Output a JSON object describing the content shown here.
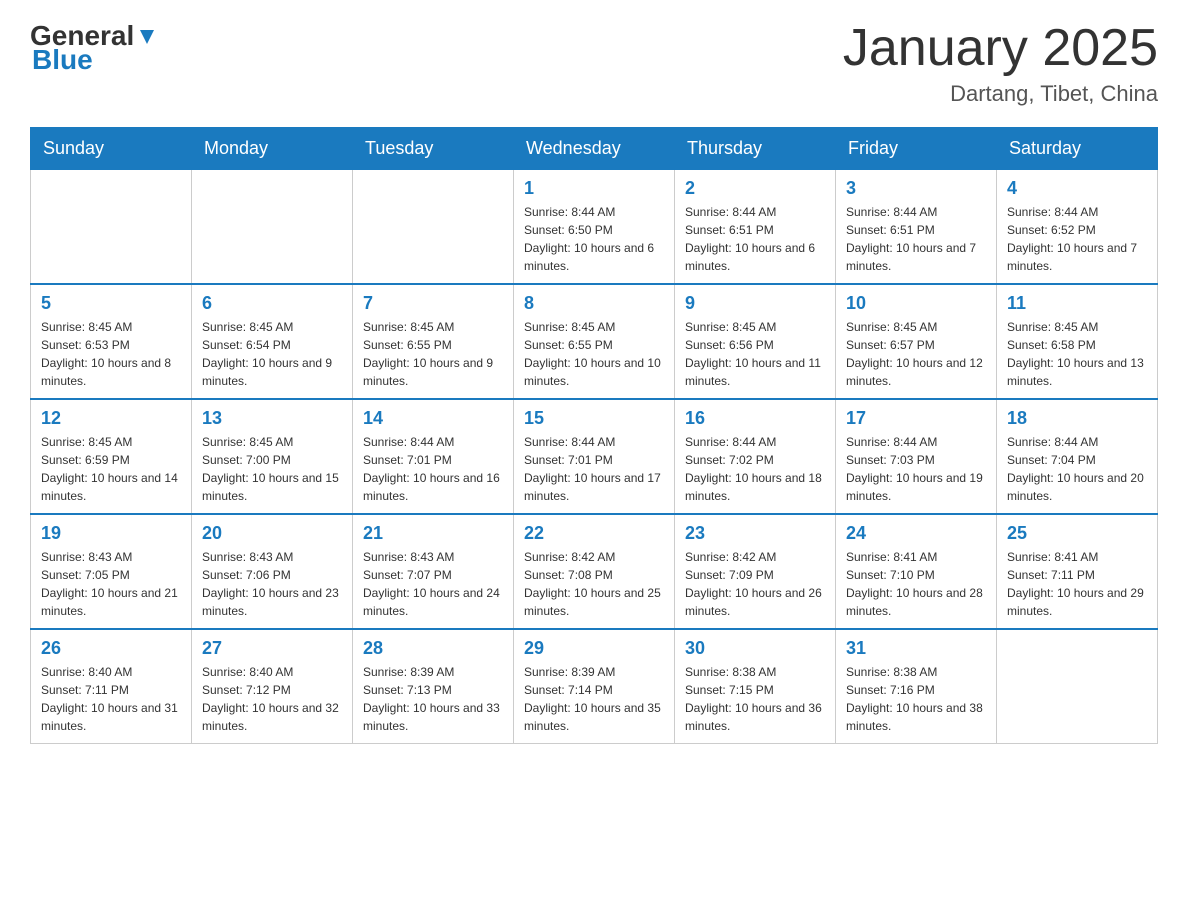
{
  "header": {
    "logo": {
      "general": "General",
      "blue": "Blue"
    },
    "title": "January 2025",
    "subtitle": "Dartang, Tibet, China"
  },
  "days_of_week": [
    "Sunday",
    "Monday",
    "Tuesday",
    "Wednesday",
    "Thursday",
    "Friday",
    "Saturday"
  ],
  "weeks": [
    {
      "days": [
        {
          "number": "",
          "info": ""
        },
        {
          "number": "",
          "info": ""
        },
        {
          "number": "",
          "info": ""
        },
        {
          "number": "1",
          "info": "Sunrise: 8:44 AM\nSunset: 6:50 PM\nDaylight: 10 hours and 6 minutes."
        },
        {
          "number": "2",
          "info": "Sunrise: 8:44 AM\nSunset: 6:51 PM\nDaylight: 10 hours and 6 minutes."
        },
        {
          "number": "3",
          "info": "Sunrise: 8:44 AM\nSunset: 6:51 PM\nDaylight: 10 hours and 7 minutes."
        },
        {
          "number": "4",
          "info": "Sunrise: 8:44 AM\nSunset: 6:52 PM\nDaylight: 10 hours and 7 minutes."
        }
      ]
    },
    {
      "days": [
        {
          "number": "5",
          "info": "Sunrise: 8:45 AM\nSunset: 6:53 PM\nDaylight: 10 hours and 8 minutes."
        },
        {
          "number": "6",
          "info": "Sunrise: 8:45 AM\nSunset: 6:54 PM\nDaylight: 10 hours and 9 minutes."
        },
        {
          "number": "7",
          "info": "Sunrise: 8:45 AM\nSunset: 6:55 PM\nDaylight: 10 hours and 9 minutes."
        },
        {
          "number": "8",
          "info": "Sunrise: 8:45 AM\nSunset: 6:55 PM\nDaylight: 10 hours and 10 minutes."
        },
        {
          "number": "9",
          "info": "Sunrise: 8:45 AM\nSunset: 6:56 PM\nDaylight: 10 hours and 11 minutes."
        },
        {
          "number": "10",
          "info": "Sunrise: 8:45 AM\nSunset: 6:57 PM\nDaylight: 10 hours and 12 minutes."
        },
        {
          "number": "11",
          "info": "Sunrise: 8:45 AM\nSunset: 6:58 PM\nDaylight: 10 hours and 13 minutes."
        }
      ]
    },
    {
      "days": [
        {
          "number": "12",
          "info": "Sunrise: 8:45 AM\nSunset: 6:59 PM\nDaylight: 10 hours and 14 minutes."
        },
        {
          "number": "13",
          "info": "Sunrise: 8:45 AM\nSunset: 7:00 PM\nDaylight: 10 hours and 15 minutes."
        },
        {
          "number": "14",
          "info": "Sunrise: 8:44 AM\nSunset: 7:01 PM\nDaylight: 10 hours and 16 minutes."
        },
        {
          "number": "15",
          "info": "Sunrise: 8:44 AM\nSunset: 7:01 PM\nDaylight: 10 hours and 17 minutes."
        },
        {
          "number": "16",
          "info": "Sunrise: 8:44 AM\nSunset: 7:02 PM\nDaylight: 10 hours and 18 minutes."
        },
        {
          "number": "17",
          "info": "Sunrise: 8:44 AM\nSunset: 7:03 PM\nDaylight: 10 hours and 19 minutes."
        },
        {
          "number": "18",
          "info": "Sunrise: 8:44 AM\nSunset: 7:04 PM\nDaylight: 10 hours and 20 minutes."
        }
      ]
    },
    {
      "days": [
        {
          "number": "19",
          "info": "Sunrise: 8:43 AM\nSunset: 7:05 PM\nDaylight: 10 hours and 21 minutes."
        },
        {
          "number": "20",
          "info": "Sunrise: 8:43 AM\nSunset: 7:06 PM\nDaylight: 10 hours and 23 minutes."
        },
        {
          "number": "21",
          "info": "Sunrise: 8:43 AM\nSunset: 7:07 PM\nDaylight: 10 hours and 24 minutes."
        },
        {
          "number": "22",
          "info": "Sunrise: 8:42 AM\nSunset: 7:08 PM\nDaylight: 10 hours and 25 minutes."
        },
        {
          "number": "23",
          "info": "Sunrise: 8:42 AM\nSunset: 7:09 PM\nDaylight: 10 hours and 26 minutes."
        },
        {
          "number": "24",
          "info": "Sunrise: 8:41 AM\nSunset: 7:10 PM\nDaylight: 10 hours and 28 minutes."
        },
        {
          "number": "25",
          "info": "Sunrise: 8:41 AM\nSunset: 7:11 PM\nDaylight: 10 hours and 29 minutes."
        }
      ]
    },
    {
      "days": [
        {
          "number": "26",
          "info": "Sunrise: 8:40 AM\nSunset: 7:11 PM\nDaylight: 10 hours and 31 minutes."
        },
        {
          "number": "27",
          "info": "Sunrise: 8:40 AM\nSunset: 7:12 PM\nDaylight: 10 hours and 32 minutes."
        },
        {
          "number": "28",
          "info": "Sunrise: 8:39 AM\nSunset: 7:13 PM\nDaylight: 10 hours and 33 minutes."
        },
        {
          "number": "29",
          "info": "Sunrise: 8:39 AM\nSunset: 7:14 PM\nDaylight: 10 hours and 35 minutes."
        },
        {
          "number": "30",
          "info": "Sunrise: 8:38 AM\nSunset: 7:15 PM\nDaylight: 10 hours and 36 minutes."
        },
        {
          "number": "31",
          "info": "Sunrise: 8:38 AM\nSunset: 7:16 PM\nDaylight: 10 hours and 38 minutes."
        },
        {
          "number": "",
          "info": ""
        }
      ]
    }
  ]
}
